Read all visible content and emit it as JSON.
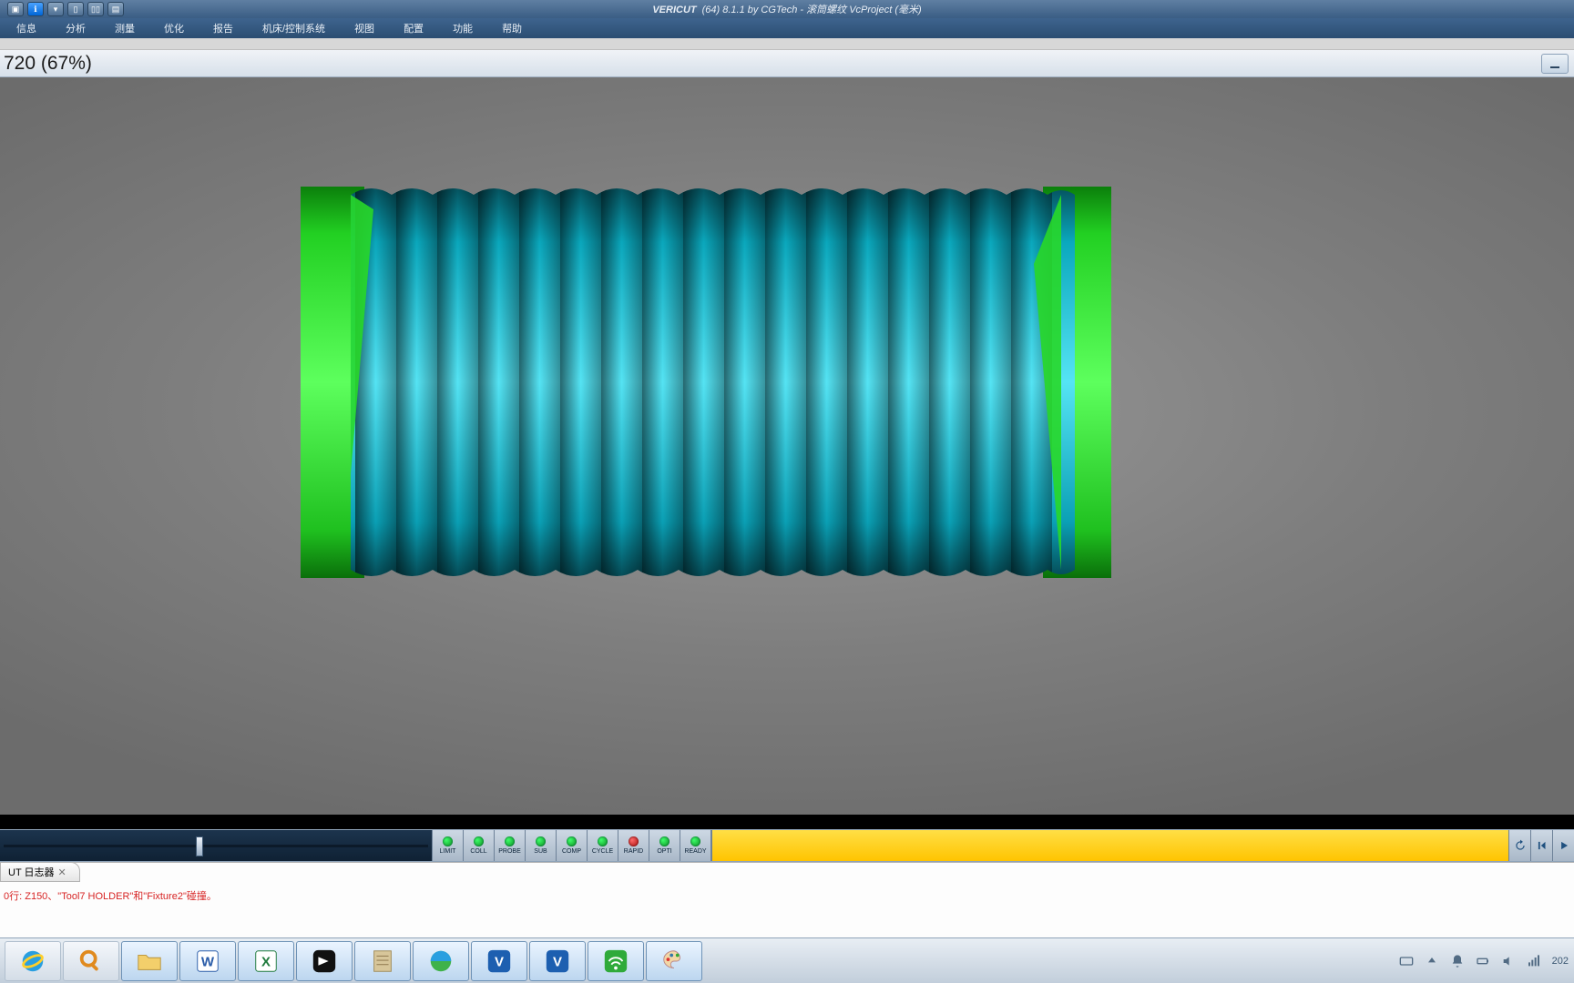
{
  "titlebar": {
    "brand": "VERICUT",
    "suffix": "(64) 8.1.1 by CGTech - 滚筒螺纹 VcProject (毫米)"
  },
  "menu": [
    "信息",
    "分析",
    "测量",
    "优化",
    "报告",
    "机床/控制系统",
    "视图",
    "配置",
    "功能",
    "帮助"
  ],
  "viewport": {
    "label": "720 (67%)"
  },
  "leds": [
    {
      "label": "LIMIT",
      "state": "ok"
    },
    {
      "label": "COLL",
      "state": "ok"
    },
    {
      "label": "PROBE",
      "state": "ok"
    },
    {
      "label": "SUB",
      "state": "ok"
    },
    {
      "label": "COMP",
      "state": "ok"
    },
    {
      "label": "CYCLE",
      "state": "ok"
    },
    {
      "label": "RAPID",
      "state": "err"
    },
    {
      "label": "OPTI",
      "state": "ok"
    },
    {
      "label": "READY",
      "state": "ok"
    }
  ],
  "log": {
    "tab": "UT 日志器",
    "line2": "0行: Z150、\"Tool7 HOLDER\"和\"Fixture2\"碰撞。"
  },
  "taskbar_apps": [
    {
      "name": "ie",
      "active": false
    },
    {
      "name": "magnify",
      "active": false
    },
    {
      "name": "explorer",
      "active": true
    },
    {
      "name": "word",
      "active": true
    },
    {
      "name": "excel",
      "active": true
    },
    {
      "name": "capcut",
      "active": true
    },
    {
      "name": "notes",
      "active": true
    },
    {
      "name": "ie2",
      "active": true
    },
    {
      "name": "vericut",
      "active": true
    },
    {
      "name": "vericut2",
      "active": true
    },
    {
      "name": "wifi",
      "active": true
    },
    {
      "name": "paint",
      "active": true
    }
  ],
  "clock": "202"
}
